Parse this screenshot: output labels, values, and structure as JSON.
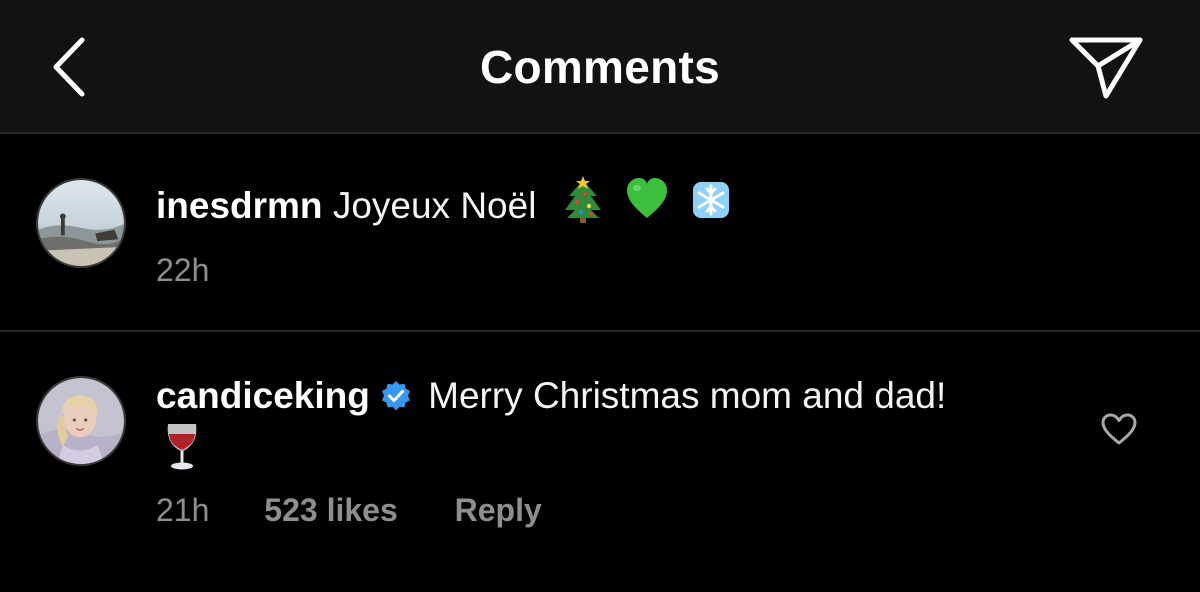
{
  "header": {
    "title": "Comments",
    "back_icon": "chevron-left-icon",
    "share_icon": "paper-plane-icon"
  },
  "comments": [
    {
      "username": "inesdrmn",
      "text": "Joyeux Noël",
      "emojis": [
        "christmas-tree",
        "green-heart",
        "snowflake"
      ],
      "time": "22h",
      "verified": false
    },
    {
      "username": "candiceking",
      "text": "Merry Christmas mom and dad!",
      "emojis": [
        "wine-glass"
      ],
      "time": "21h",
      "likes": "523 likes",
      "reply": "Reply",
      "verified": true,
      "like_icon": "heart-outline-icon"
    }
  ],
  "colors": {
    "background": "#000000",
    "header_background": "#121212",
    "divider": "#262626",
    "primary_text": "#ffffff",
    "secondary_text": "#8e8e8e",
    "verified_badge": "#3897f0"
  }
}
